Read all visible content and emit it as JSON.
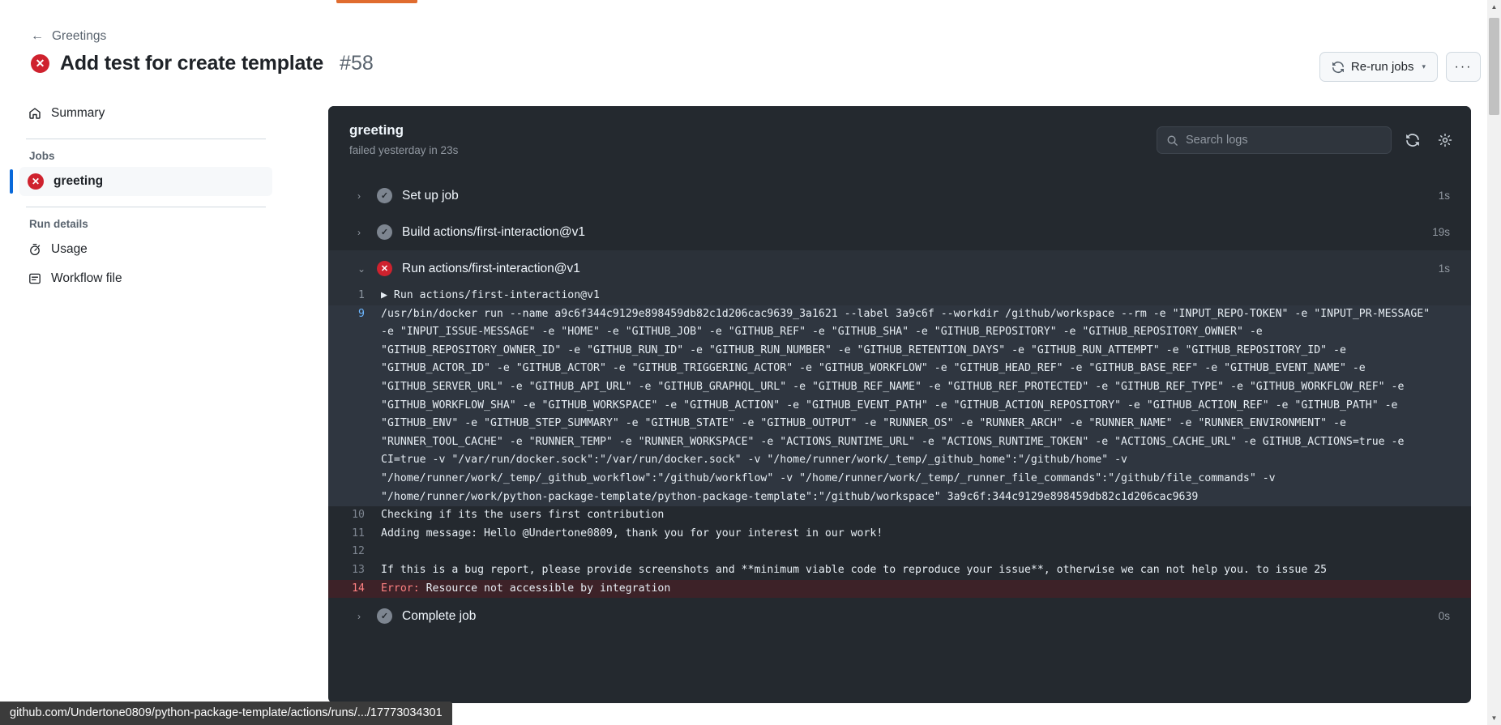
{
  "header": {
    "breadcrumb_label": "Greetings",
    "back_icon": "arrow-left-icon",
    "run_title": "Add test for create template",
    "run_number": "#58",
    "run_status_glyph": "✕",
    "rerun_label": "Re-run jobs",
    "rerun_caret": "▾",
    "more_label": "···"
  },
  "sidebar": {
    "summary_label": "Summary",
    "jobs_heading": "Jobs",
    "job_label": "greeting",
    "job_status_glyph": "✕",
    "run_details_heading": "Run details",
    "usage_label": "Usage",
    "workflow_file_label": "Workflow file"
  },
  "panel": {
    "title": "greeting",
    "subtitle": "failed yesterday in 23s",
    "search_placeholder": "Search logs",
    "search_value": "",
    "refresh_title": "refresh-icon",
    "settings_title": "gear-icon"
  },
  "steps": [
    {
      "label": "Set up job",
      "status": "success",
      "glyph": "✓",
      "duration": "1s",
      "chevron": "›",
      "expanded": false
    },
    {
      "label": "Build actions/first-interaction@v1",
      "status": "success",
      "glyph": "✓",
      "duration": "19s",
      "chevron": "›",
      "expanded": false
    },
    {
      "label": "Run actions/first-interaction@v1",
      "status": "failure",
      "glyph": "✕",
      "duration": "1s",
      "chevron": "⌄",
      "expanded": true
    },
    {
      "label": "Complete job",
      "status": "success",
      "glyph": "✓",
      "duration": "0s",
      "chevron": "›",
      "expanded": false
    }
  ],
  "log": {
    "lines": [
      {
        "num": "1",
        "kind": "group",
        "prefix": "▶ ",
        "text": "Run actions/first-interaction@v1"
      },
      {
        "num": "9",
        "kind": "highlight",
        "prefix": "",
        "text": "/usr/bin/docker run --name a9c6f344c9129e898459db82c1d206cac9639_3a1621 --label 3a9c6f --workdir /github/workspace --rm -e \"INPUT_REPO-TOKEN\" -e \"INPUT_PR-MESSAGE\" -e \"INPUT_ISSUE-MESSAGE\" -e \"HOME\" -e \"GITHUB_JOB\" -e \"GITHUB_REF\" -e \"GITHUB_SHA\" -e \"GITHUB_REPOSITORY\" -e \"GITHUB_REPOSITORY_OWNER\" -e \"GITHUB_REPOSITORY_OWNER_ID\" -e \"GITHUB_RUN_ID\" -e \"GITHUB_RUN_NUMBER\" -e \"GITHUB_RETENTION_DAYS\" -e \"GITHUB_RUN_ATTEMPT\" -e \"GITHUB_REPOSITORY_ID\" -e \"GITHUB_ACTOR_ID\" -e \"GITHUB_ACTOR\" -e \"GITHUB_TRIGGERING_ACTOR\" -e \"GITHUB_WORKFLOW\" -e \"GITHUB_HEAD_REF\" -e \"GITHUB_BASE_REF\" -e \"GITHUB_EVENT_NAME\" -e \"GITHUB_SERVER_URL\" -e \"GITHUB_API_URL\" -e \"GITHUB_GRAPHQL_URL\" -e \"GITHUB_REF_NAME\" -e \"GITHUB_REF_PROTECTED\" -e \"GITHUB_REF_TYPE\" -e \"GITHUB_WORKFLOW_REF\" -e \"GITHUB_WORKFLOW_SHA\" -e \"GITHUB_WORKSPACE\" -e \"GITHUB_ACTION\" -e \"GITHUB_EVENT_PATH\" -e \"GITHUB_ACTION_REPOSITORY\" -e \"GITHUB_ACTION_REF\" -e \"GITHUB_PATH\" -e \"GITHUB_ENV\" -e \"GITHUB_STEP_SUMMARY\" -e \"GITHUB_STATE\" -e \"GITHUB_OUTPUT\" -e \"RUNNER_OS\" -e \"RUNNER_ARCH\" -e \"RUNNER_NAME\" -e \"RUNNER_ENVIRONMENT\" -e \"RUNNER_TOOL_CACHE\" -e \"RUNNER_TEMP\" -e \"RUNNER_WORKSPACE\" -e \"ACTIONS_RUNTIME_URL\" -e \"ACTIONS_RUNTIME_TOKEN\" -e \"ACTIONS_CACHE_URL\" -e GITHUB_ACTIONS=true -e CI=true -v \"/var/run/docker.sock\":\"/var/run/docker.sock\" -v \"/home/runner/work/_temp/_github_home\":\"/github/home\" -v \"/home/runner/work/_temp/_github_workflow\":\"/github/workflow\" -v \"/home/runner/work/_temp/_runner_file_commands\":\"/github/file_commands\" -v \"/home/runner/work/python-package-template/python-package-template\":\"/github/workspace\" 3a9c6f:344c9129e898459db82c1d206cac9639"
      },
      {
        "num": "10",
        "kind": "plain",
        "prefix": "",
        "text": "Checking if its the users first contribution"
      },
      {
        "num": "11",
        "kind": "plain",
        "prefix": "",
        "text": "Adding message: Hello @Undertone0809, thank you for your interest in our work!"
      },
      {
        "num": "12",
        "kind": "plain",
        "prefix": "",
        "text": ""
      },
      {
        "num": "13",
        "kind": "plain",
        "prefix": "",
        "text": "If this is a bug report, please provide screenshots and **minimum viable code to reproduce your issue**, otherwise we can not help you. to issue 25"
      },
      {
        "num": "14",
        "kind": "error",
        "prefix": "",
        "error_keyword": "Error:",
        "text": " Resource not accessible by integration"
      }
    ]
  },
  "status_bar": {
    "url": "github.com/Undertone0809/python-package-template/actions/runs/.../17773034301"
  },
  "colors": {
    "danger": "#cf222e",
    "accent": "#0969da",
    "panel_bg": "#24292f",
    "tab_active": "#e06c2f"
  }
}
